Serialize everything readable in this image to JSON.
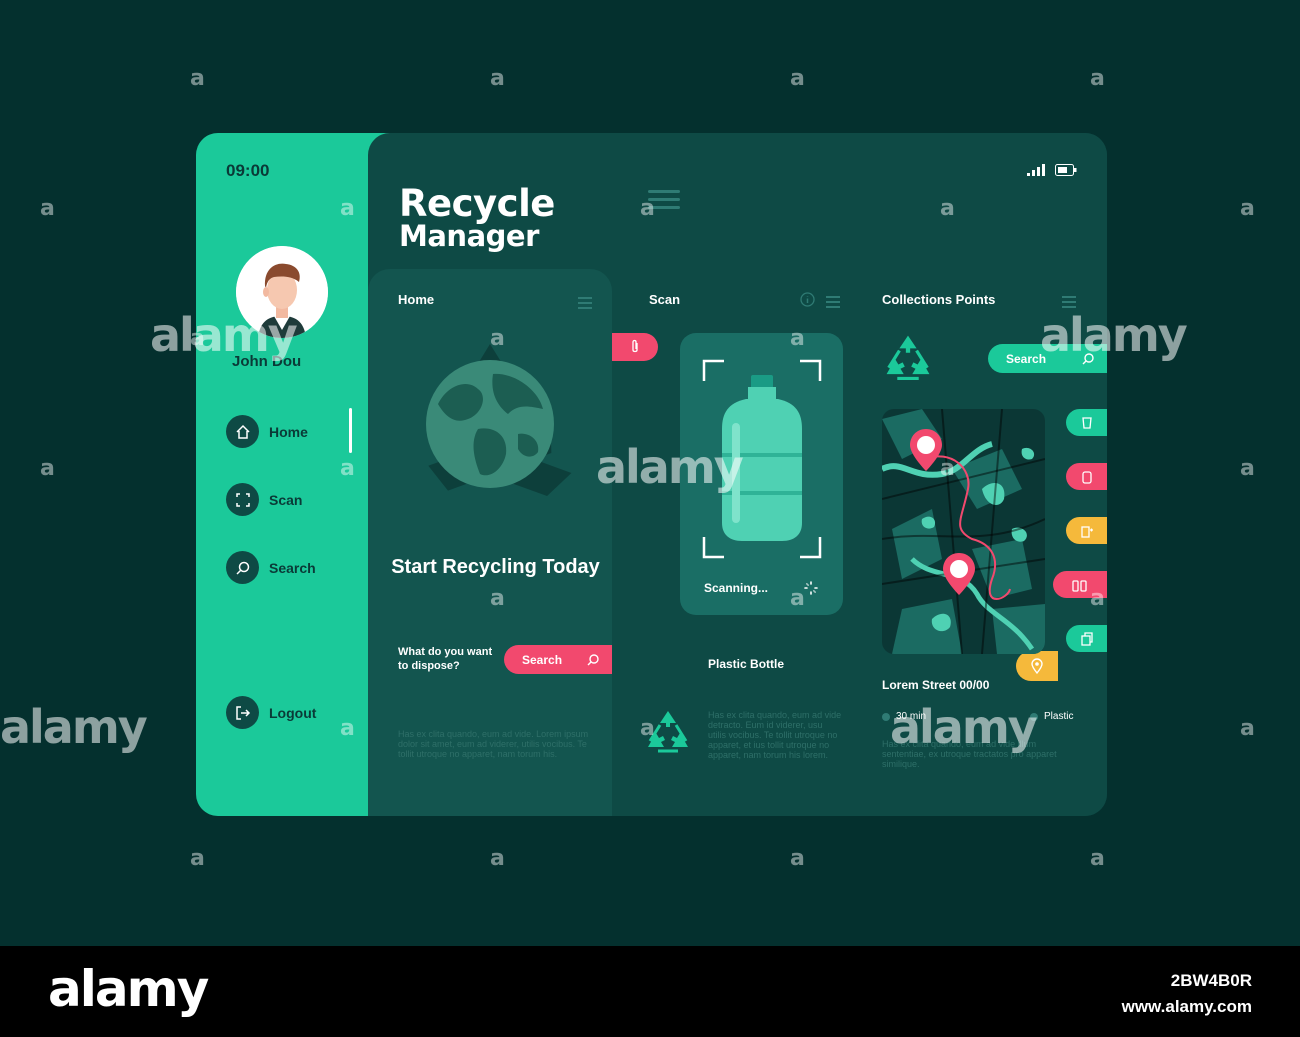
{
  "status_bar": {
    "time": "09:00"
  },
  "user": {
    "name": "John Dou"
  },
  "nav": {
    "items": [
      {
        "label": "Home",
        "icon": "home-icon"
      },
      {
        "label": "Scan",
        "icon": "scan-icon"
      },
      {
        "label": "Search",
        "icon": "search-icon"
      }
    ],
    "logout": "Logout"
  },
  "header": {
    "title_line1": "Recycle",
    "title_line2": "Manager"
  },
  "home": {
    "title": "Home",
    "headline": "Start Recycling Today",
    "question": "What do you want to dispose?",
    "search_label": "Search",
    "lorem": "Has ex clita quando, eum ad vide. Lorem ipsum dolor sit amet, eum ad viderer, utilis vocibus. Te tollit utroque no apparet, nam torum his."
  },
  "scan": {
    "title": "Scan",
    "status": "Scanning...",
    "item_label": "Plastic Bottle",
    "lorem": "Has ex clita quando, eum ad vide detracto. Eum id viderer, usu utilis vocibus. Te tollit utroque no apparet, et ius tollit utroque no apparet, nam torum his lorem."
  },
  "collections": {
    "title": "Collections Points",
    "search_label": "Search",
    "street": "Lorem Street 00/00",
    "legend_time": "30 min",
    "legend_type": "Plastic",
    "lorem": "Has ex clita quando, eum ad vide illum sententiae, ex utroque tractatos pro apparet similique."
  },
  "colors": {
    "accent_green": "#1bc99a",
    "pink": "#f2496e",
    "yellow": "#f5b93b",
    "dark_teal": "#0e4a45",
    "background": "#04302e"
  },
  "watermark": {
    "brand": "alamy",
    "mark": "a",
    "image_id": "2BW4B0R",
    "site": "www.alamy.com"
  }
}
